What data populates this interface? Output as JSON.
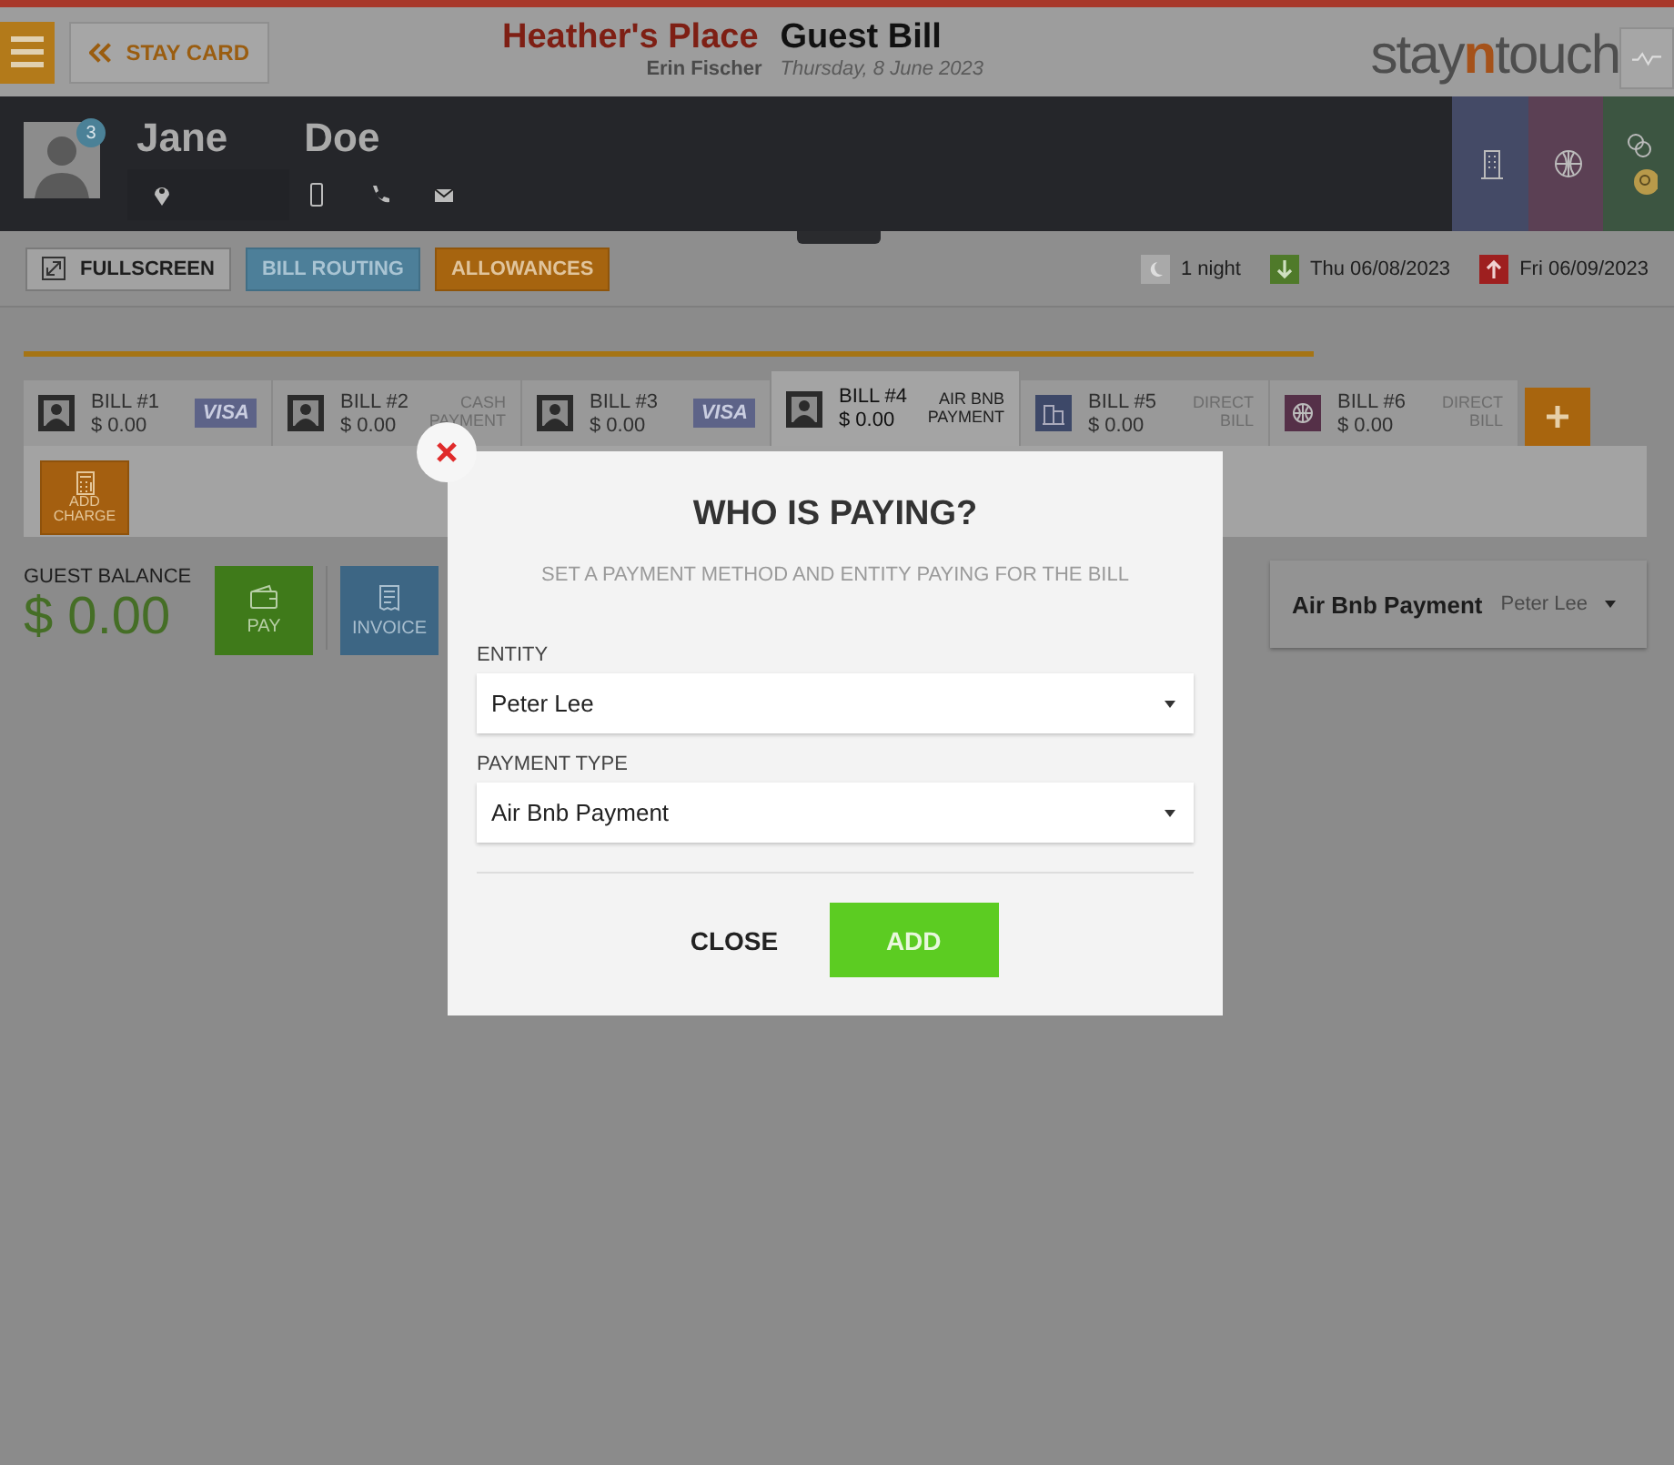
{
  "header": {
    "back_button": "STAY CARD",
    "hotel": "Heather's Place",
    "title": "Guest Bill",
    "user": "Erin Fischer",
    "date": "Thursday, 8 June 2023",
    "logo": [
      {
        "text": "stay",
        "accent": false
      },
      {
        "text": "n",
        "accent": true
      },
      {
        "text": "touch",
        "accent": false
      }
    ]
  },
  "guest": {
    "first_name": "Jane",
    "last_name": "Doe",
    "badge": "3"
  },
  "toolbar": {
    "buttons": [
      {
        "label": "FULLSCREEN",
        "kind": "fullscreen"
      },
      {
        "label": "BILL ROUTING",
        "kind": "blue"
      },
      {
        "label": "ALLOWANCES",
        "kind": "orange"
      }
    ],
    "stay": [
      {
        "kind": "nights",
        "text": "1 night"
      },
      {
        "kind": "arrival",
        "text": "Thu 06/08/2023"
      },
      {
        "kind": "departure",
        "text": "Fri 06/09/2023"
      }
    ]
  },
  "bills": [
    {
      "kind": "guest",
      "label": "BILL #1",
      "amount": "$ 0.00",
      "payment": {
        "kind": "card",
        "text": "VISA"
      },
      "selected": false
    },
    {
      "kind": "guest",
      "label": "BILL #2",
      "amount": "$ 0.00",
      "payment": {
        "kind": "method",
        "text": "CASH PAYMENT"
      },
      "selected": false
    },
    {
      "kind": "guest",
      "label": "BILL #3",
      "amount": "$ 0.00",
      "payment": {
        "kind": "card",
        "text": "VISA"
      },
      "selected": false
    },
    {
      "kind": "guest",
      "label": "BILL #4",
      "amount": "$ 0.00",
      "payment": {
        "kind": "method",
        "text": "AIR BNB PAYMENT"
      },
      "selected": true
    },
    {
      "kind": "company",
      "label": "BILL #5",
      "amount": "$ 0.00",
      "payment": {
        "kind": "method",
        "text": "DIRECT BILL"
      },
      "selected": false
    },
    {
      "kind": "agent",
      "label": "BILL #6",
      "amount": "$ 0.00",
      "payment": {
        "kind": "method",
        "text": "DIRECT BILL"
      },
      "selected": false
    }
  ],
  "add_charge": "ADD CHARGE",
  "balance": {
    "label": "GUEST BALANCE",
    "amount": "$ 0.00"
  },
  "actions": [
    {
      "label": "PAY",
      "kind": "pay"
    },
    {
      "label": "INVOICE",
      "kind": "invoice"
    }
  ],
  "payer": {
    "method": "Air Bnb Payment",
    "entity": "Peter Lee"
  },
  "dialog": {
    "title": "WHO IS PAYING?",
    "subtitle": "SET A PAYMENT METHOD AND ENTITY PAYING FOR THE BILL",
    "fields": [
      {
        "label": "ENTITY",
        "value": "Peter Lee"
      },
      {
        "label": "PAYMENT TYPE",
        "value": "Air Bnb Payment"
      }
    ],
    "close": "CLOSE",
    "add": "ADD"
  }
}
